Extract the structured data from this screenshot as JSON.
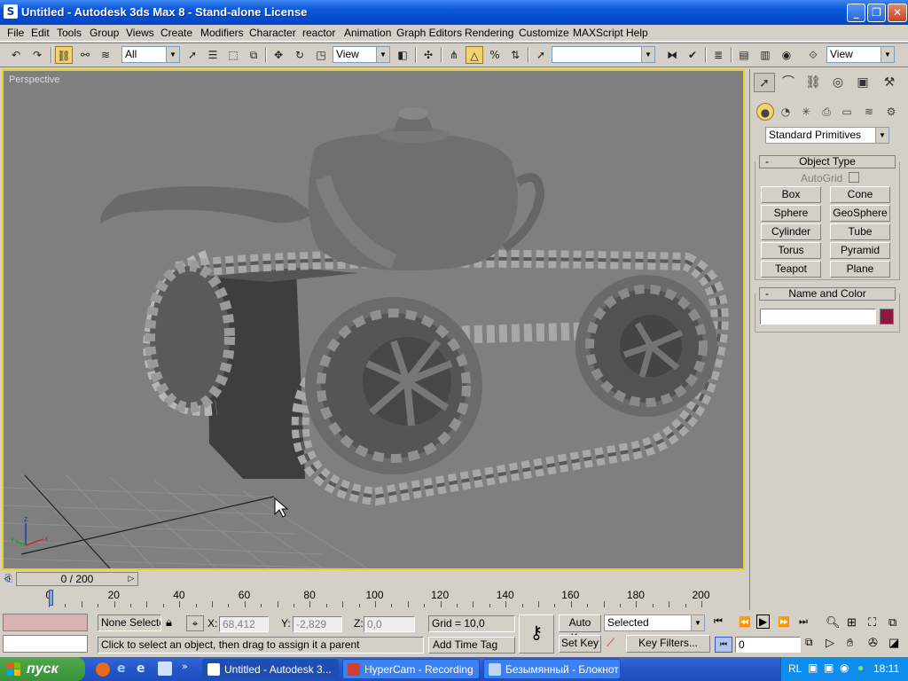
{
  "window": {
    "title": "Untitled - Autodesk 3ds Max 8  - Stand-alone License",
    "app_icon": "S"
  },
  "menu": [
    "File",
    "Edit",
    "Tools",
    "Group",
    "Views",
    "Create",
    "Modifiers",
    "Character",
    "reactor",
    "Animation",
    "Graph Editors",
    "Rendering",
    "Customize",
    "MAXScript",
    "Help"
  ],
  "toolbar": {
    "selection_filter": "All",
    "ref_coord": "View",
    "named_selection": "",
    "view_dropdown": "View"
  },
  "viewport": {
    "label": "Perspective"
  },
  "command_panel": {
    "category": "Standard Primitives",
    "object_type_title": "Object Type",
    "autogrid_label": "AutoGrid",
    "buttons": [
      "Box",
      "Cone",
      "Sphere",
      "GeoSphere",
      "Cylinder",
      "Tube",
      "Torus",
      "Pyramid",
      "Teapot",
      "Plane"
    ],
    "name_color_title": "Name and Color",
    "name_value": "",
    "object_color": "#8b1a3c"
  },
  "timeline": {
    "frame_display": "0 / 200",
    "current_frame": 0,
    "total_frames": 200,
    "labels": [
      "0",
      "20",
      "40",
      "60",
      "80",
      "100",
      "120",
      "140",
      "160",
      "180",
      "200"
    ]
  },
  "status": {
    "selection": "None Selecte",
    "x_label": "X:",
    "x_value": "68,412",
    "y_label": "Y:",
    "y_value": "-2,829",
    "z_label": "Z:",
    "z_value": "0,0",
    "grid": "Grid = 10,0",
    "prompt": "Click to select an object, then drag to assign it a parent",
    "add_time_tag": "Add Time Tag",
    "auto_key": "Auto Key",
    "set_key": "Set Key",
    "key_mode": "Selected",
    "key_filters": "Key Filters...",
    "frame_field": "0"
  },
  "taskbar": {
    "start_label": "пуск",
    "tasks": [
      "Untitled - Autodesk 3...",
      "HyperCam - Recording",
      "Безымянный - Блокнот"
    ],
    "lang": "RL",
    "clock": "18:11"
  }
}
